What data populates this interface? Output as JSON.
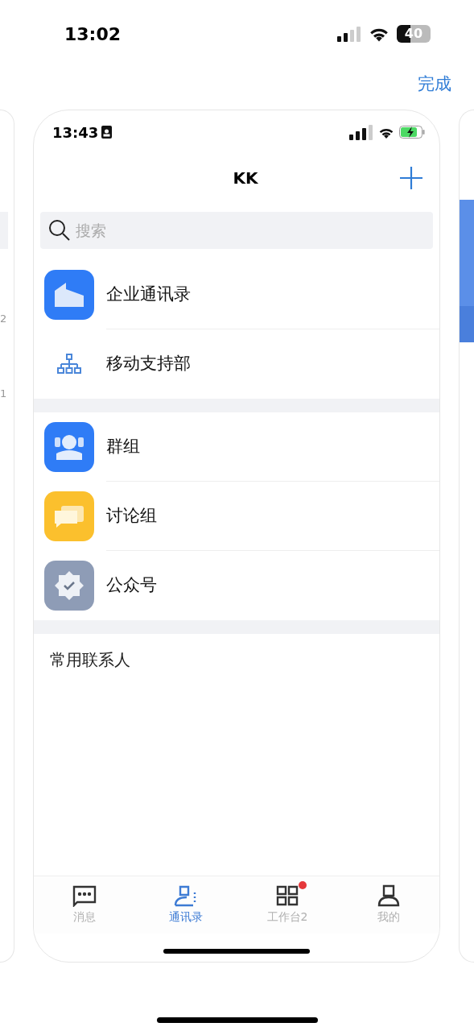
{
  "status_bar": {
    "time": "13:02",
    "battery": "40"
  },
  "done_button": "完成",
  "left_card": {
    "texts": [
      "2",
      "1"
    ]
  },
  "app_card": {
    "status_bar": {
      "time": "13:43"
    },
    "title": "KK",
    "search": {
      "placeholder": "搜索"
    },
    "sections": [
      {
        "items": [
          {
            "label": "企业通讯录",
            "kind": "building"
          },
          {
            "label": "移动支持部",
            "kind": "org"
          }
        ]
      },
      {
        "items": [
          {
            "label": "群组",
            "kind": "group"
          },
          {
            "label": "讨论组",
            "kind": "discussion"
          },
          {
            "label": "公众号",
            "kind": "official"
          }
        ]
      }
    ],
    "frequent_header": "常用联系人",
    "tabs": [
      {
        "label": "消息",
        "kind": "chat",
        "selected": false,
        "badge": false
      },
      {
        "label": "通讯录",
        "kind": "contacts",
        "selected": true,
        "badge": false
      },
      {
        "label": "工作台2",
        "kind": "workbench",
        "selected": false,
        "badge": true
      },
      {
        "label": "我的",
        "kind": "me",
        "selected": false,
        "badge": false
      }
    ]
  }
}
